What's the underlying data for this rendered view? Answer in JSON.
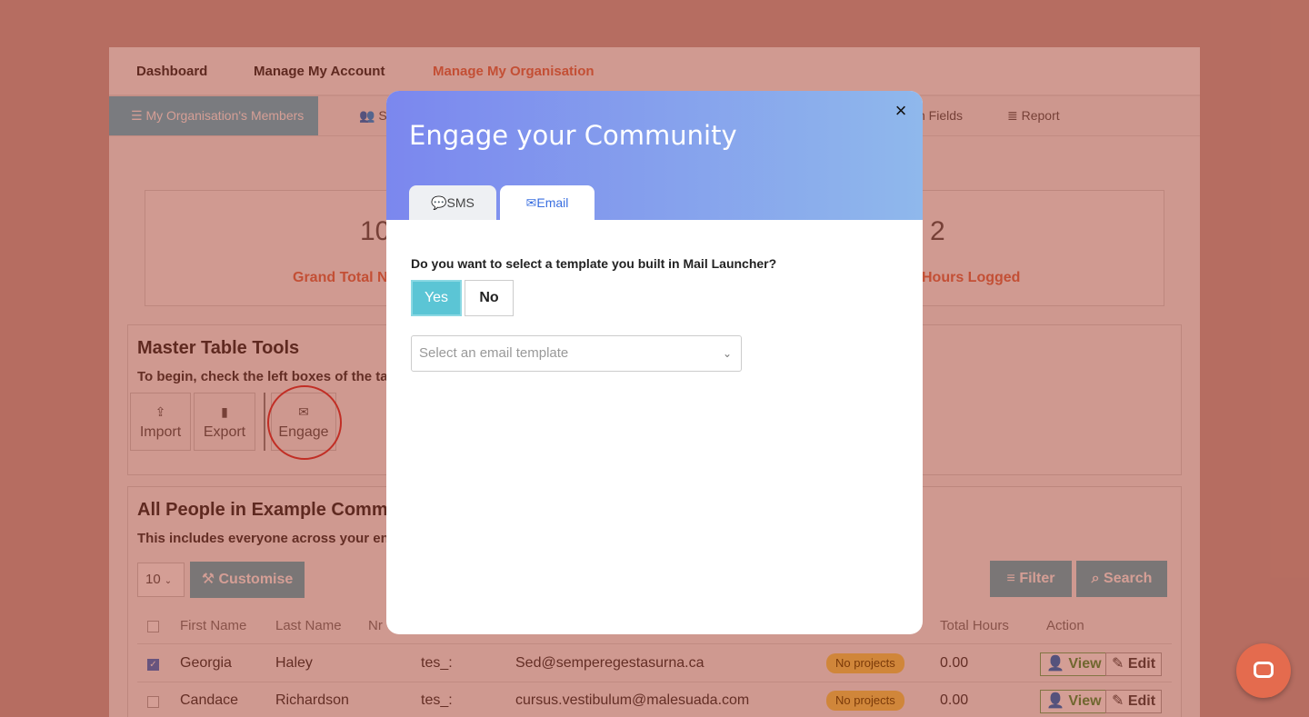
{
  "topnav": {
    "items": [
      "Dashboard",
      "Manage My Account",
      "Manage My Organisation"
    ],
    "active_color": "#e07050"
  },
  "subnav": {
    "items": [
      "My Organisation's Members",
      "S",
      "n Fields",
      "Report"
    ]
  },
  "stats": {
    "left_value": "10",
    "left_label": "Grand Total Nu",
    "right_value": "2",
    "right_label": "Hours Logged"
  },
  "tools": {
    "title": "Master Table Tools",
    "subtitle": "To begin, check the left boxes of the tab",
    "buttons": [
      {
        "label": "Import",
        "icon": "upload-icon"
      },
      {
        "label": "Export",
        "icon": "clipboard-icon"
      },
      {
        "label": "Engage",
        "icon": "envelope-icon"
      }
    ]
  },
  "people": {
    "title": "All People in Example Commun",
    "subtitle": "This includes everyone across your ent",
    "page_size": "10",
    "customise_label": "Customise",
    "filter_label": "Filter",
    "search_label": "Search",
    "columns": [
      "First Name",
      "Last Name",
      "Nr",
      "Total Hours",
      "Action"
    ],
    "rows": [
      {
        "first": "Georgia",
        "last": "Haley",
        "nr": "tes_:",
        "email": "Sed@semperegestasurna.ca",
        "projects": "No projects",
        "hours": "0.00",
        "checked": true
      },
      {
        "first": "Candace",
        "last": "Richardson",
        "nr": "tes_:",
        "email": "cursus.vestibulum@malesuada.com",
        "projects": "No projects",
        "hours": "0.00",
        "checked": false
      }
    ],
    "view_label": "View",
    "edit_label": "Edit"
  },
  "modal": {
    "title": "Engage your Community",
    "close": "×",
    "tabs": [
      "SMS",
      "Email"
    ],
    "active_tab": "Email",
    "question": "Do you want to select a template you built in Mail Launcher?",
    "yes_label": "Yes",
    "no_label": "No",
    "template_placeholder": "Select an email template"
  }
}
